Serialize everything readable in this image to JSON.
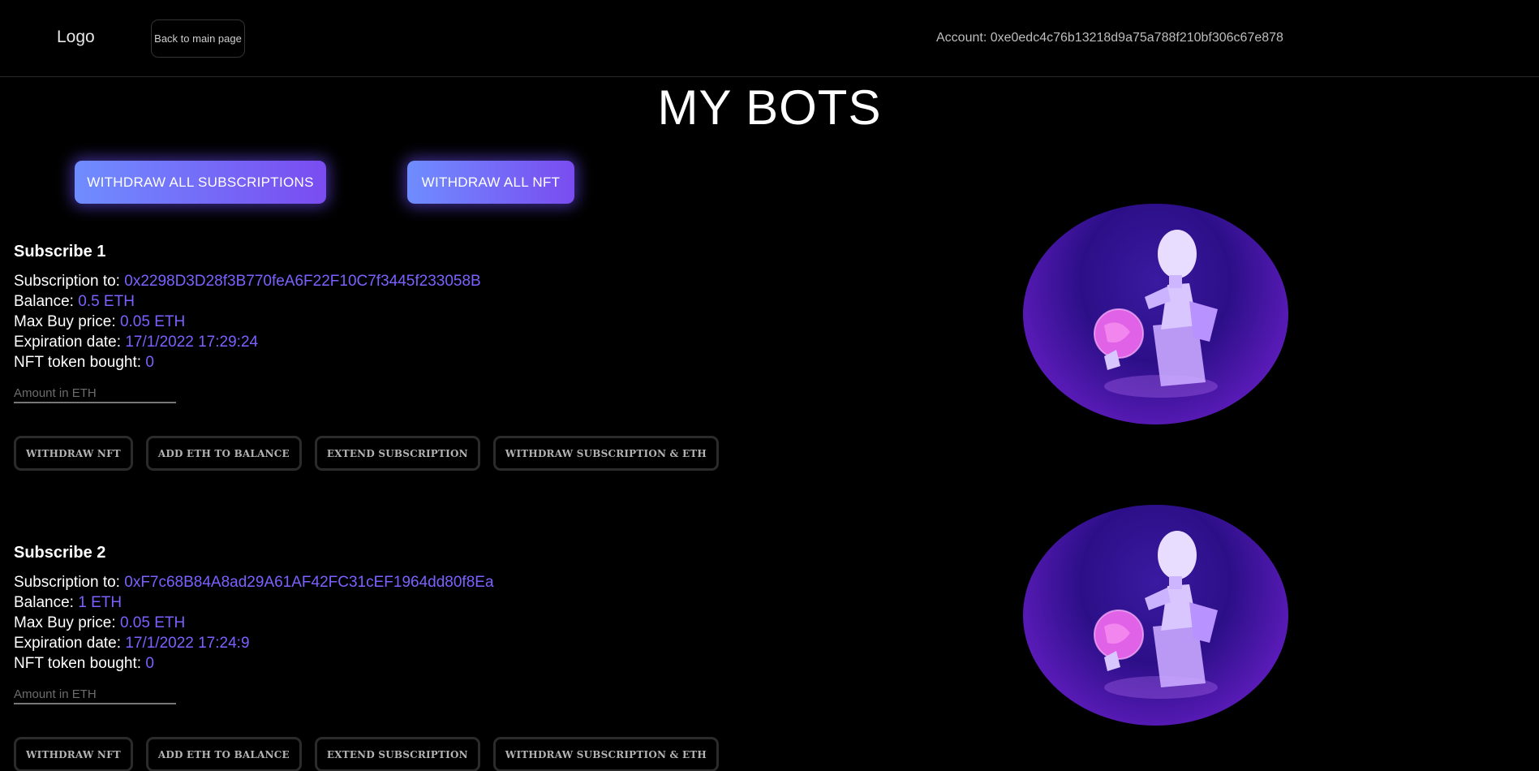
{
  "header": {
    "logo": "Logo",
    "back_label": "Back to main page",
    "account_label": "Account: 0xe0edc4c76b13218d9a75a788f210bf306c67e878"
  },
  "page_title": "MY BOTS",
  "actions": {
    "withdraw_all_subscriptions": "WITHDRAW ALL SUBSCRIPTIONS",
    "withdraw_all_nft": "WITHDRAW ALL NFT"
  },
  "labels": {
    "subscription_to": "Subscription to: ",
    "balance": "Balance: ",
    "max_buy_price": "Max Buy price: ",
    "expiration_date": "Expiration date: ",
    "nft_bought": "NFT token bought: ",
    "amount_placeholder": "Amount in ETH",
    "withdraw_nft": "WITHDRAW NFT",
    "add_eth": "ADD ETH TO BALANCE",
    "extend": "EXTEND SUBSCRIPTION",
    "withdraw_sub_eth": "WITHDRAW SUBSCRIPTION & ETH"
  },
  "subscriptions": [
    {
      "title": "Subscribe 1",
      "subscription_to": "0x2298D3D28f3B770feA6F22F10C7f3445f233058B",
      "balance": "0.5 ETH",
      "max_buy_price": "0.05 ETH",
      "expiration_date": "17/1/2022 17:29:24",
      "nft_bought": "0"
    },
    {
      "title": "Subscribe 2",
      "subscription_to": "0xF7c68B84A8ad29A61AF42FC31cEF1964dd80f8Ea",
      "balance": "1 ETH",
      "max_buy_price": "0.05 ETH",
      "expiration_date": "17/1/2022 17:24:9",
      "nft_bought": "0"
    }
  ],
  "colors": {
    "accent": "#7b61ff",
    "button_gradient_start": "#6f8dff",
    "button_gradient_end": "#7a4cf0"
  }
}
